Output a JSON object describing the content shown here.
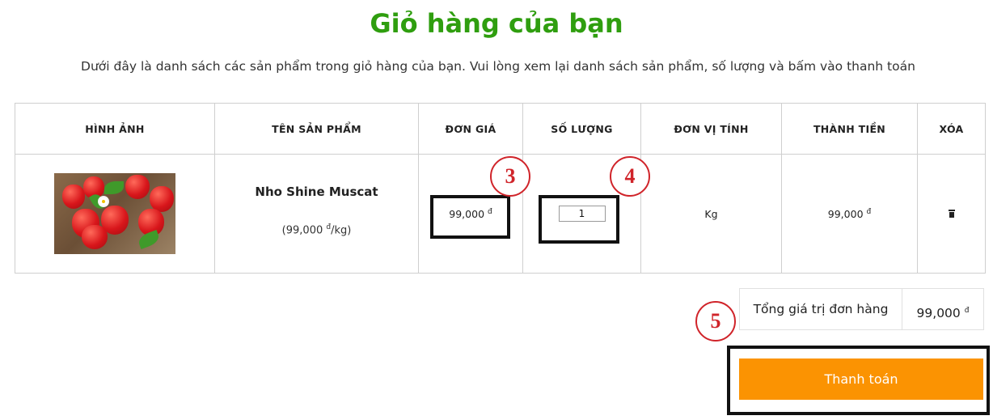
{
  "page": {
    "title": "Giỏ hàng của bạn",
    "subtitle": "Dưới đây là danh sách các sản phẩm trong giỏ hàng của bạn. Vui lòng xem lại danh sách sản phẩm, số lượng và bấm vào thanh toán"
  },
  "table": {
    "headers": [
      "HÌNH ẢNH",
      "TÊN SẢN PHẨM",
      "ĐƠN GIÁ",
      "SỐ LƯỢNG",
      "ĐƠN VỊ TÍNH",
      "THÀNH TIỀN",
      "XÓA"
    ],
    "row": {
      "image_icon": "strawberry-product-photo",
      "name": "Nho Shine Muscat",
      "unit_price_line": "(99,000 ",
      "unit_price_currency": "đ",
      "unit_price_suffix": "/kg)",
      "price": "99,000 ",
      "price_currency": "đ",
      "quantity": "1",
      "unit": "Kg",
      "line_total": "99,000 ",
      "line_total_currency": "đ",
      "delete_icon": "trash-icon"
    }
  },
  "summary": {
    "label": "Tổng giá trị đơn hàng",
    "value": "99,000 ",
    "currency": "đ"
  },
  "checkout": {
    "label": "Thanh toán"
  },
  "annotations": [
    "3",
    "4",
    "5"
  ],
  "colors": {
    "title": "#2f9e0f",
    "checkout_button": "#fb9302",
    "annotation": "#d0242a"
  }
}
